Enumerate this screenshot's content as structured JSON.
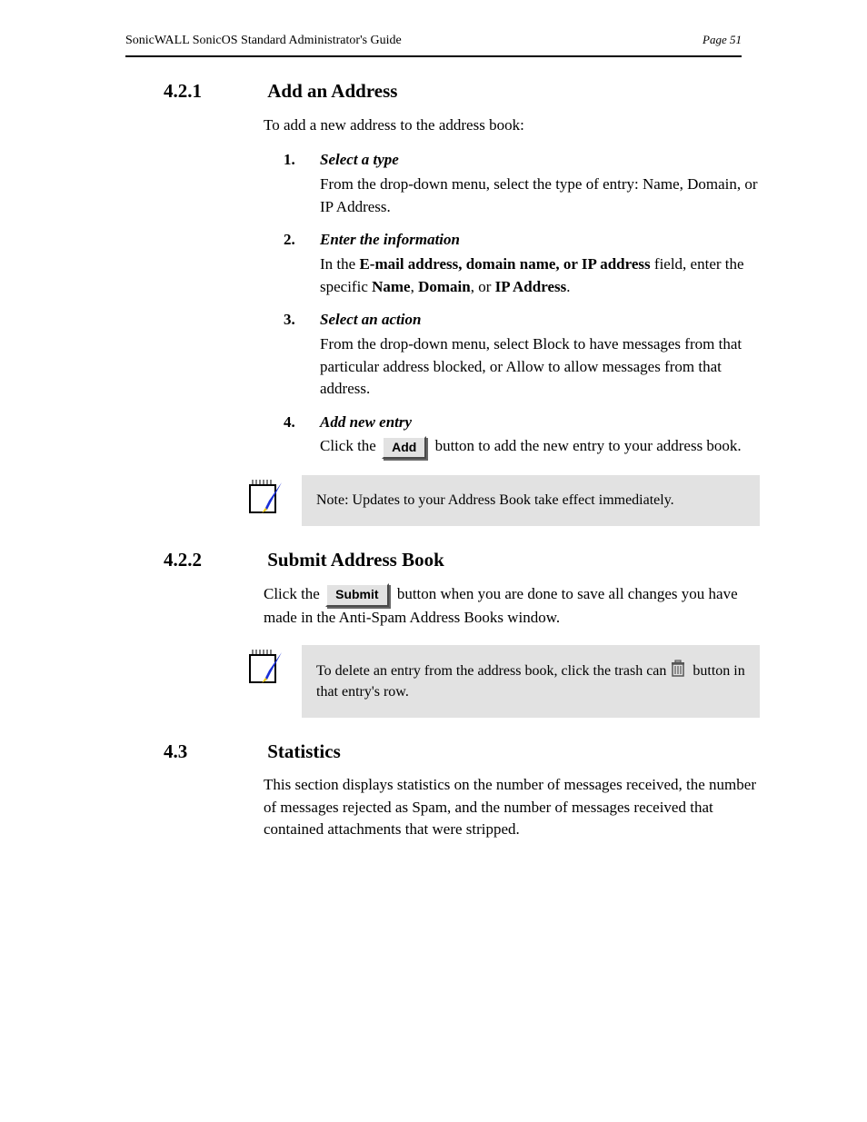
{
  "header": {
    "title": "SonicWALL SonicOS Standard Administrator's Guide",
    "subtitle": "Page 51"
  },
  "section1": {
    "num": "4.2.1",
    "title": "Add an Address",
    "intro": "To add a new address to the address book:",
    "steps": [
      {
        "n": "1.",
        "head": "Select a type",
        "body": "From the drop-down menu, select the type of entry: Name, Domain, or IP Address."
      },
      {
        "n": "2.",
        "head": "Enter the information",
        "body_before_field": "In the ",
        "field1": "E-mail address, domain name, or IP address",
        "body_mid": " field, enter the specific ",
        "field2": "Name",
        "body_mid2": ", ",
        "field3": "Domain",
        "body_mid3": ", or ",
        "field4": "IP Address",
        "body_after": "."
      },
      {
        "n": "3.",
        "head": "Select an action",
        "body": "From the drop-down menu, select Block to have messages from that particular address blocked, or Allow to allow messages from that address."
      },
      {
        "n": "4.",
        "head": "Add new entry",
        "body_before_btn": "Click the ",
        "btn": "Add",
        "body_after_btn": " button to add the new entry to your address book."
      }
    ],
    "note": "Note: Updates to your Address Book take effect immediately."
  },
  "section2": {
    "num": "4.2.2",
    "title": "Submit Address Book",
    "para_before": "Click the ",
    "btn": "Submit",
    "para_after": " button when you are done to save all changes you have made in the Anti-Spam Address Books window.",
    "note_before": "To delete an entry from the address book, click the trash can ",
    "note_after": " button in that entry's row."
  },
  "section3": {
    "num": "4.3",
    "title": "Statistics",
    "para": "This section displays statistics on the number of messages received, the number of messages rejected as Spam, and the number of messages received that contained attachments that were stripped."
  }
}
